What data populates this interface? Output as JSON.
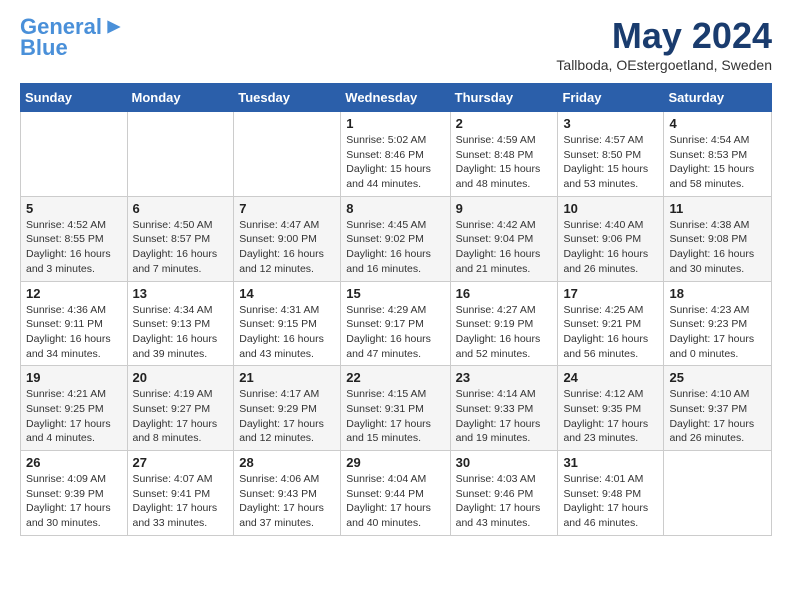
{
  "header": {
    "logo_line1": "General",
    "logo_line2": "Blue",
    "month_title": "May 2024",
    "location": "Tallboda, OEstergoetland, Sweden"
  },
  "days_of_week": [
    "Sunday",
    "Monday",
    "Tuesday",
    "Wednesday",
    "Thursday",
    "Friday",
    "Saturday"
  ],
  "weeks": [
    [
      {
        "day": "",
        "info": ""
      },
      {
        "day": "",
        "info": ""
      },
      {
        "day": "",
        "info": ""
      },
      {
        "day": "1",
        "info": "Sunrise: 5:02 AM\nSunset: 8:46 PM\nDaylight: 15 hours\nand 44 minutes."
      },
      {
        "day": "2",
        "info": "Sunrise: 4:59 AM\nSunset: 8:48 PM\nDaylight: 15 hours\nand 48 minutes."
      },
      {
        "day": "3",
        "info": "Sunrise: 4:57 AM\nSunset: 8:50 PM\nDaylight: 15 hours\nand 53 minutes."
      },
      {
        "day": "4",
        "info": "Sunrise: 4:54 AM\nSunset: 8:53 PM\nDaylight: 15 hours\nand 58 minutes."
      }
    ],
    [
      {
        "day": "5",
        "info": "Sunrise: 4:52 AM\nSunset: 8:55 PM\nDaylight: 16 hours\nand 3 minutes."
      },
      {
        "day": "6",
        "info": "Sunrise: 4:50 AM\nSunset: 8:57 PM\nDaylight: 16 hours\nand 7 minutes."
      },
      {
        "day": "7",
        "info": "Sunrise: 4:47 AM\nSunset: 9:00 PM\nDaylight: 16 hours\nand 12 minutes."
      },
      {
        "day": "8",
        "info": "Sunrise: 4:45 AM\nSunset: 9:02 PM\nDaylight: 16 hours\nand 16 minutes."
      },
      {
        "day": "9",
        "info": "Sunrise: 4:42 AM\nSunset: 9:04 PM\nDaylight: 16 hours\nand 21 minutes."
      },
      {
        "day": "10",
        "info": "Sunrise: 4:40 AM\nSunset: 9:06 PM\nDaylight: 16 hours\nand 26 minutes."
      },
      {
        "day": "11",
        "info": "Sunrise: 4:38 AM\nSunset: 9:08 PM\nDaylight: 16 hours\nand 30 minutes."
      }
    ],
    [
      {
        "day": "12",
        "info": "Sunrise: 4:36 AM\nSunset: 9:11 PM\nDaylight: 16 hours\nand 34 minutes."
      },
      {
        "day": "13",
        "info": "Sunrise: 4:34 AM\nSunset: 9:13 PM\nDaylight: 16 hours\nand 39 minutes."
      },
      {
        "day": "14",
        "info": "Sunrise: 4:31 AM\nSunset: 9:15 PM\nDaylight: 16 hours\nand 43 minutes."
      },
      {
        "day": "15",
        "info": "Sunrise: 4:29 AM\nSunset: 9:17 PM\nDaylight: 16 hours\nand 47 minutes."
      },
      {
        "day": "16",
        "info": "Sunrise: 4:27 AM\nSunset: 9:19 PM\nDaylight: 16 hours\nand 52 minutes."
      },
      {
        "day": "17",
        "info": "Sunrise: 4:25 AM\nSunset: 9:21 PM\nDaylight: 16 hours\nand 56 minutes."
      },
      {
        "day": "18",
        "info": "Sunrise: 4:23 AM\nSunset: 9:23 PM\nDaylight: 17 hours\nand 0 minutes."
      }
    ],
    [
      {
        "day": "19",
        "info": "Sunrise: 4:21 AM\nSunset: 9:25 PM\nDaylight: 17 hours\nand 4 minutes."
      },
      {
        "day": "20",
        "info": "Sunrise: 4:19 AM\nSunset: 9:27 PM\nDaylight: 17 hours\nand 8 minutes."
      },
      {
        "day": "21",
        "info": "Sunrise: 4:17 AM\nSunset: 9:29 PM\nDaylight: 17 hours\nand 12 minutes."
      },
      {
        "day": "22",
        "info": "Sunrise: 4:15 AM\nSunset: 9:31 PM\nDaylight: 17 hours\nand 15 minutes."
      },
      {
        "day": "23",
        "info": "Sunrise: 4:14 AM\nSunset: 9:33 PM\nDaylight: 17 hours\nand 19 minutes."
      },
      {
        "day": "24",
        "info": "Sunrise: 4:12 AM\nSunset: 9:35 PM\nDaylight: 17 hours\nand 23 minutes."
      },
      {
        "day": "25",
        "info": "Sunrise: 4:10 AM\nSunset: 9:37 PM\nDaylight: 17 hours\nand 26 minutes."
      }
    ],
    [
      {
        "day": "26",
        "info": "Sunrise: 4:09 AM\nSunset: 9:39 PM\nDaylight: 17 hours\nand 30 minutes."
      },
      {
        "day": "27",
        "info": "Sunrise: 4:07 AM\nSunset: 9:41 PM\nDaylight: 17 hours\nand 33 minutes."
      },
      {
        "day": "28",
        "info": "Sunrise: 4:06 AM\nSunset: 9:43 PM\nDaylight: 17 hours\nand 37 minutes."
      },
      {
        "day": "29",
        "info": "Sunrise: 4:04 AM\nSunset: 9:44 PM\nDaylight: 17 hours\nand 40 minutes."
      },
      {
        "day": "30",
        "info": "Sunrise: 4:03 AM\nSunset: 9:46 PM\nDaylight: 17 hours\nand 43 minutes."
      },
      {
        "day": "31",
        "info": "Sunrise: 4:01 AM\nSunset: 9:48 PM\nDaylight: 17 hours\nand 46 minutes."
      },
      {
        "day": "",
        "info": ""
      }
    ]
  ]
}
